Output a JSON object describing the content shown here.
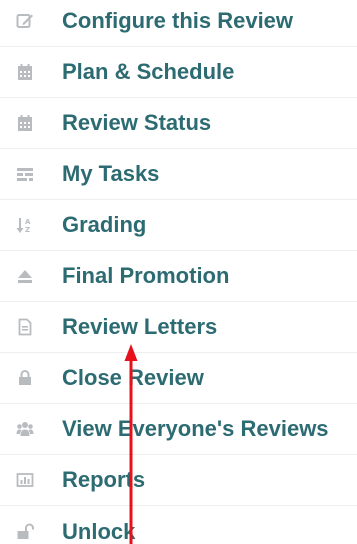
{
  "menu": {
    "items": [
      {
        "label": "Configure this Review",
        "icon": "edit-icon"
      },
      {
        "label": "Plan & Schedule",
        "icon": "calendar-icon"
      },
      {
        "label": "Review Status",
        "icon": "calendar-icon"
      },
      {
        "label": "My Tasks",
        "icon": "tasks-icon"
      },
      {
        "label": "Grading",
        "icon": "sort-icon"
      },
      {
        "label": "Final Promotion",
        "icon": "eject-icon"
      },
      {
        "label": "Review Letters",
        "icon": "document-icon"
      },
      {
        "label": "Close Review",
        "icon": "lock-icon"
      },
      {
        "label": "View Everyone's Reviews",
        "icon": "users-icon"
      },
      {
        "label": "Reports",
        "icon": "bar-chart-icon"
      },
      {
        "label": "Unlock",
        "icon": "unlock-icon"
      }
    ]
  },
  "colors": {
    "label": "#2d6b72",
    "icon": "#b9bcbf",
    "arrow": "#e8101a"
  }
}
